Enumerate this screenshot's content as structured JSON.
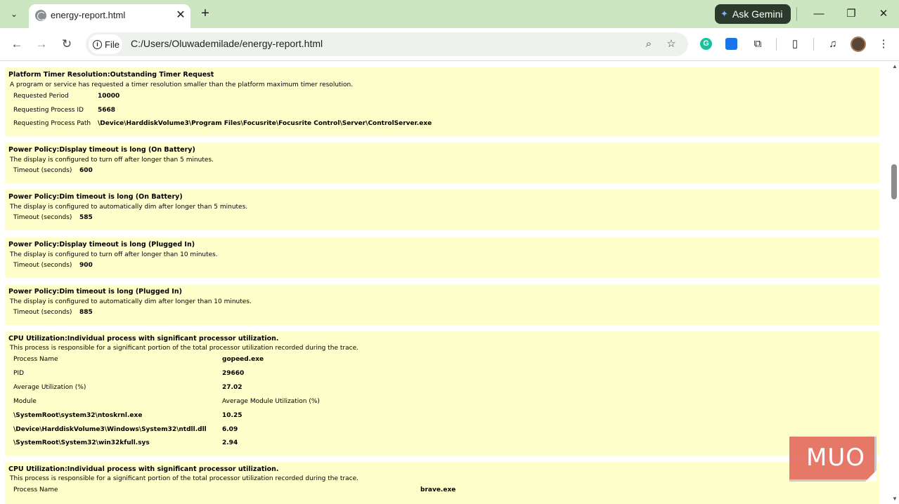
{
  "browser": {
    "tab_title": "energy-report.html",
    "tab_close": "✕",
    "new_tab": "+",
    "gemini_label": "Ask Gemini",
    "url_scheme": "File",
    "url": "C:/Users/Oluwademilade/energy-report.html",
    "controls": {
      "minimize": "—",
      "restore": "❐",
      "close": "✕"
    }
  },
  "sections": [
    {
      "title": "Platform Timer Resolution:Outstanding Timer Request",
      "description": "A program or service has requested a timer resolution smaller than the platform maximum timer resolution.",
      "rows": [
        {
          "label": "Requested Period",
          "value": "10000"
        },
        {
          "label": "Requesting Process ID",
          "value": "5668"
        },
        {
          "label": "Requesting Process Path",
          "value": "\\Device\\HarddiskVolume3\\Program Files\\Focusrite\\Focusrite Control\\Server\\ControlServer.exe"
        }
      ]
    },
    {
      "title": "Power Policy:Display timeout is long (On Battery)",
      "description": "The display is configured to turn off after longer than 5 minutes.",
      "rows": [
        {
          "label": "Timeout (seconds)",
          "value": "600"
        }
      ]
    },
    {
      "title": "Power Policy:Dim timeout is long (On Battery)",
      "description": "The display is configured to automatically dim after longer than 5 minutes.",
      "rows": [
        {
          "label": "Timeout (seconds)",
          "value": "585"
        }
      ]
    },
    {
      "title": "Power Policy:Display timeout is long (Plugged In)",
      "description": "The display is configured to turn off after longer than 10 minutes.",
      "rows": [
        {
          "label": "Timeout (seconds)",
          "value": "900"
        }
      ]
    },
    {
      "title": "Power Policy:Dim timeout is long (Plugged In)",
      "description": "The display is configured to automatically dim after longer than 10 minutes.",
      "rows": [
        {
          "label": "Timeout (seconds)",
          "value": "885"
        }
      ]
    },
    {
      "title": "CPU Utilization:Individual process with significant processor utilization.",
      "description": "This process is responsible for a significant portion of the total processor utilization recorded during the trace.",
      "rows": [
        {
          "label": "Process Name",
          "value": "gopeed.exe"
        },
        {
          "label": "PID",
          "value": "29660"
        },
        {
          "label": "Average Utilization (%)",
          "value": "27.02"
        },
        {
          "label": "Module",
          "value": "Average Module Utilization (%)"
        }
      ],
      "modules": [
        {
          "path": "\\SystemRoot\\system32\\ntoskrnl.exe",
          "value": "10.25"
        },
        {
          "path": "\\Device\\HarddiskVolume3\\Windows\\System32\\ntdll.dll",
          "value": "6.09"
        },
        {
          "path": "\\SystemRoot\\System32\\win32kfull.sys",
          "value": "2.94"
        }
      ]
    },
    {
      "title": "CPU Utilization:Individual process with significant processor utilization.",
      "description": "This process is responsible for a significant portion of the total processor utilization recorded during the trace.",
      "rows": [
        {
          "label": "Process Name",
          "value": "brave.exe"
        }
      ]
    }
  ],
  "watermark": "MUO"
}
